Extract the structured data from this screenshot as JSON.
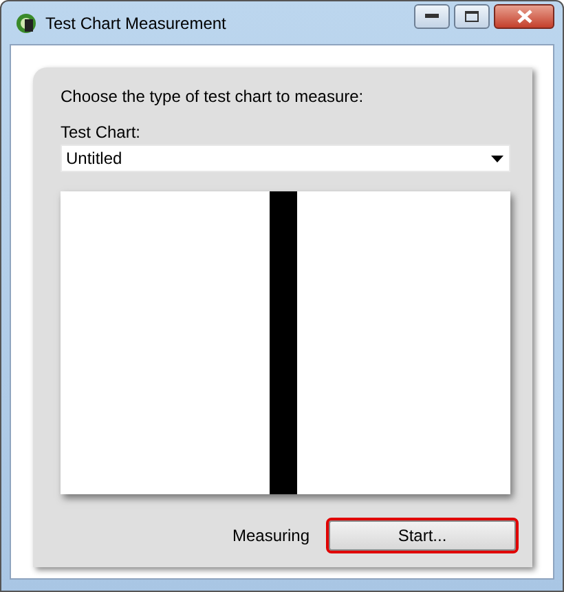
{
  "window": {
    "title": "Test Chart Measurement"
  },
  "prompt": "Choose the type of test chart to measure:",
  "chart_select": {
    "label": "Test Chart:",
    "value": "Untitled"
  },
  "status": "Measuring",
  "start_button": {
    "label": "Start...",
    "highlighted": true
  }
}
